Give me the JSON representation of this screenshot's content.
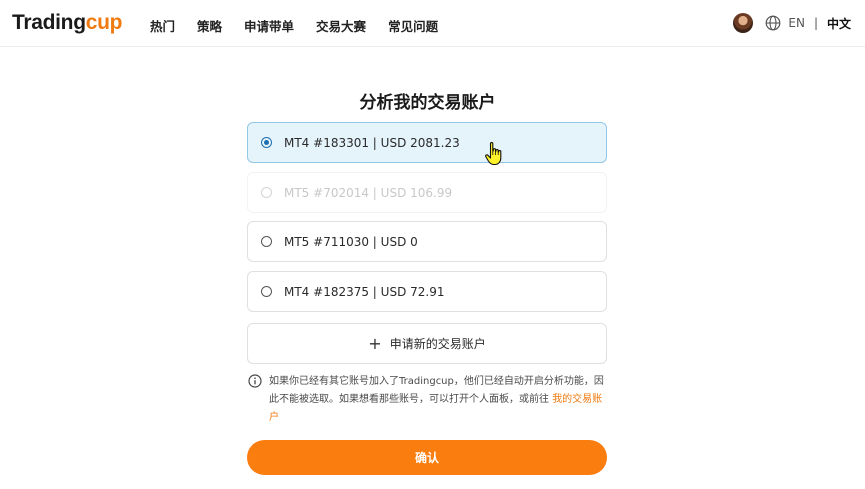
{
  "header": {
    "logo_prefix": "Trading",
    "logo_accent": "cup",
    "nav": [
      "热门",
      "策略",
      "申请带单",
      "交易大赛",
      "常见问题"
    ],
    "lang_en": "EN",
    "lang_sep": "|",
    "lang_zh": "中文"
  },
  "main": {
    "title": "分析我的交易账户",
    "accounts": [
      {
        "label": "MT4 #183301 | USD 2081.23",
        "state": "selected"
      },
      {
        "label": "MT5 #702014 | USD 106.99",
        "state": "disabled"
      },
      {
        "label": "MT5 #711030 | USD 0",
        "state": "normal"
      },
      {
        "label": "MT4 #182375 | USD 72.91",
        "state": "normal"
      }
    ],
    "add_account_label": "申请新的交易账户",
    "info_text": "如果你已经有其它账号加入了Tradingcup，他们已经自动开启分析功能，因此不能被选取。如果想看那些账号，可以打开个人面板，或前往 ",
    "info_link": "我的交易账户",
    "confirm_label": "确认"
  },
  "colors": {
    "accent": "#fa7d0f",
    "selected_bg": "#e5f3fb",
    "selected_border": "#93c8e4",
    "radio_selected": "#1e6fb0"
  },
  "icons": [
    "avatar",
    "globe-icon",
    "radio-icon",
    "plus-icon",
    "info-icon",
    "hand-cursor-icon"
  ]
}
